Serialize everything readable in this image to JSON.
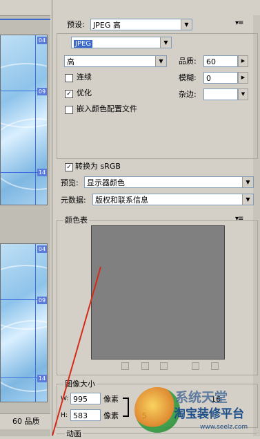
{
  "left": {
    "slice_tags_top": [
      "04",
      "09",
      "14"
    ],
    "slice_tags_bottom": [
      "04",
      "09",
      "14"
    ],
    "status_text": "60 品质"
  },
  "panel": {
    "preset_label": "预设:",
    "preset_value": "JPEG 高",
    "format_value": "JPEG",
    "quality_level": "高",
    "quality_label": "品质:",
    "quality_value": "60",
    "progressive_label": "连续",
    "progressive_checked": false,
    "blur_label": "模糊:",
    "blur_value": "0",
    "optimized_label": "优化",
    "optimized_checked": true,
    "matte_label": "杂边:",
    "matte_value": "",
    "embed_profile_label": "嵌入颜色配置文件",
    "embed_profile_checked": false,
    "convert_srgb_label": "转换为 sRGB",
    "convert_srgb_checked": true,
    "preview_label": "预览:",
    "preview_value": "显示器颜色",
    "metadata_label": "元数据:",
    "metadata_value": "版权和联系信息"
  },
  "color_table": {
    "title": "颜色表",
    "swatch_color": "#808080"
  },
  "image_size": {
    "title": "图像大小",
    "w_label": "W:",
    "w_value": "995",
    "w_unit": "像素",
    "h_label": "H:",
    "h_value": "583",
    "h_unit": "像素",
    "partial_1": "5",
    "partial_2": "16"
  },
  "animation": {
    "title": "动画"
  },
  "watermark": {
    "line1": "系统天堂",
    "line2": "淘宝装修平台",
    "url": "www.seelz.com"
  },
  "colors": {
    "panel_bg": "#d4d0c8",
    "selection_blue": "#3a67c9",
    "annotation_red": "#d42a1a"
  }
}
